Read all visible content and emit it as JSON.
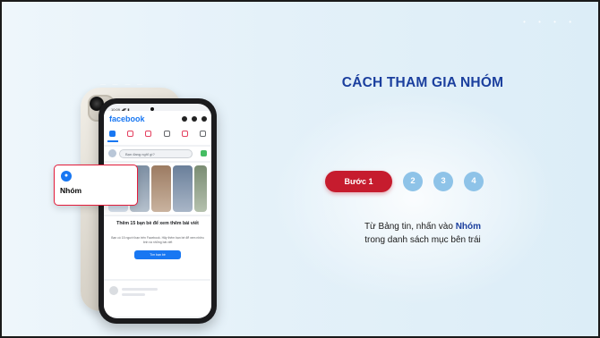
{
  "slide": {
    "title": "CÁCH THAM GIA NHÓM",
    "steps": {
      "active_label": "Bước 1",
      "others": [
        "2",
        "3",
        "4"
      ]
    },
    "description": {
      "before": "Từ Bảng tin, nhấn vào ",
      "highlight": "Nhóm",
      "after": "trong danh sách mục bên trái"
    },
    "callout": {
      "icon": "groups-icon",
      "label": "Nhóm"
    }
  },
  "phone": {
    "status_time": "10:09 ◢◤ ▮",
    "app_logo": "facebook",
    "compose_placeholder": "Bạn đang nghĩ gì?",
    "suggest_title": "Thêm 15 bạn bè để xem thêm bài viết",
    "suggest_body": "Bạn có 15 người bạn trên Facebook. Hãy thêm bạn bè để xem nhiều tình và những bài viết",
    "suggest_button": "Tìm bạn bè"
  },
  "colors": {
    "accent": "#1b3f9e",
    "active_step": "#c61c2e",
    "inactive_step": "#8ec3e8",
    "facebook_blue": "#1877f2"
  }
}
